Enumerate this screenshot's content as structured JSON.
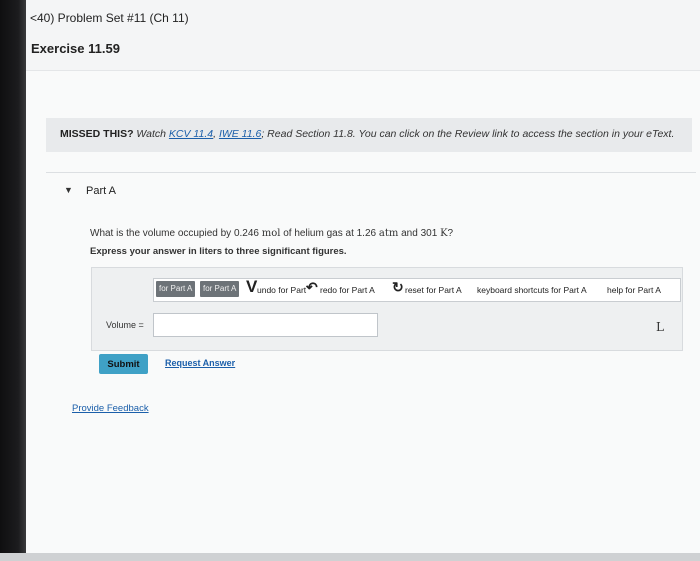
{
  "header": {
    "breadcrumb": "<40) Problem Set #11 (Ch 11)",
    "exercise_title": "Exercise 11.59"
  },
  "missed_banner": {
    "lead": "MISSED THIS?",
    "watch_text": " Watch ",
    "link1": "KCV 11.4",
    "sep1": ", ",
    "link2": "IWE 11.6",
    "rest": "; Read Section 11.8. You can click on the Review link to access the section in your eText."
  },
  "part": {
    "title": "Part A",
    "question_pre": "What is the volume occupied by 0.246 ",
    "unit_mol": "mol",
    "question_mid1": " of helium gas at 1.26 ",
    "unit_atm": "atm",
    "question_mid2": " and 301 ",
    "unit_K": "K",
    "question_end": "?",
    "instruction": "Express your answer in liters to three significant figures."
  },
  "toolbar": {
    "btn1": "for Part A",
    "btn2": "for Part A",
    "glyph_v": "V",
    "undo": "undo for Part",
    "glyph_redo": "↶",
    "redo": "redo for Part A",
    "glyph_reset": "↻",
    "reset": "reset for Part A",
    "keyboard": "keyboard shortcuts for Part A",
    "help": "help for Part A"
  },
  "answer": {
    "volume_label": "Volume =",
    "value": "",
    "unit_glyph": "L"
  },
  "actions": {
    "submit": "Submit",
    "request_answer": "Request Answer",
    "provide_feedback": "Provide Feedback"
  },
  "colors": {
    "submit_bg": "#3fa1c6",
    "link": "#1b5faa",
    "banner_bg": "#e8eaec"
  }
}
